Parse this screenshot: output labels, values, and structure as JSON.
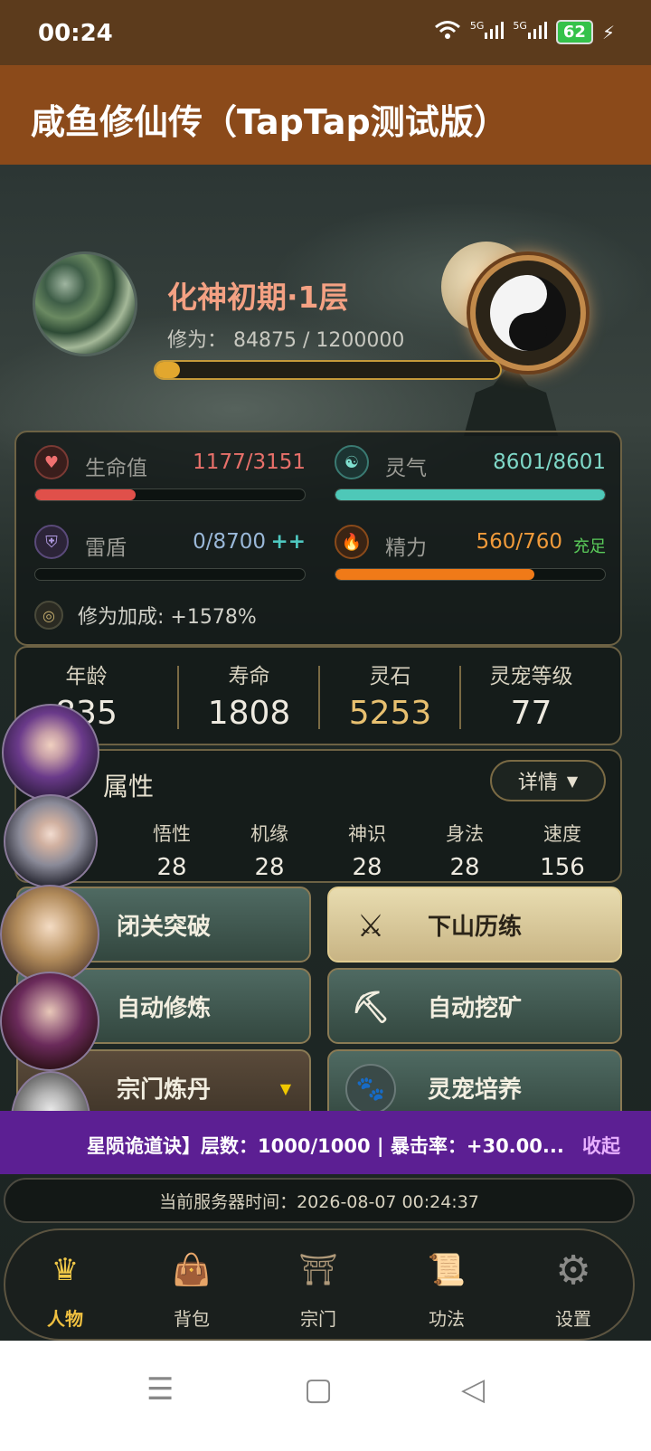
{
  "status_bar": {
    "time": "00:24",
    "signal1": "5G",
    "signal2": "5G",
    "battery": "62"
  },
  "app": {
    "title": "咸鱼修仙传（TapTap测试版）"
  },
  "player": {
    "realm": "化神初期·1层",
    "xiuwei_label": "修为：",
    "xiuwei_value": "84875 / 1200000",
    "xiuwei_progress": 0.071
  },
  "stats": {
    "hp": {
      "label": "生命值",
      "value": "1177/3151",
      "fraction": 0.373,
      "color": "#e0504a"
    },
    "qi": {
      "label": "灵气",
      "value": "8601/8601",
      "fraction": 1.0,
      "color": "#4ec8b8"
    },
    "shield": {
      "label": "雷盾",
      "value": "0/8700",
      "extra": "++",
      "fraction": 0.0,
      "color": "#4ec8c0"
    },
    "energy": {
      "label": "精力",
      "value": "560/760",
      "extra": "充足",
      "fraction": 0.737,
      "color": "#f07a18"
    },
    "bonus": "修为加成: +1578%"
  },
  "info": [
    {
      "label": "年龄",
      "value": "835"
    },
    {
      "label": "寿命",
      "value": "1808"
    },
    {
      "label": "灵石",
      "value": "5253"
    },
    {
      "label": "灵宠等级",
      "value": "77"
    }
  ],
  "attributes": {
    "title": "属性",
    "detail_button": "详情",
    "items": [
      {
        "label": "悟性",
        "value": "28"
      },
      {
        "label": "机缘",
        "value": "28"
      },
      {
        "label": "神识",
        "value": "28"
      },
      {
        "label": "身法",
        "value": "28"
      },
      {
        "label": "速度",
        "value": "156"
      }
    ]
  },
  "actions": {
    "breakthrough": "闭关突破",
    "adventure": "下山历练",
    "auto_cultivate": "自动修炼",
    "auto_mine": "自动挖矿",
    "alchemy": "宗门炼丹",
    "pet_train": "灵宠培养"
  },
  "buff": {
    "text": "星陨诡道诀】层数：1000/1000 | 暴击率：+30.00...",
    "collapse": "收起"
  },
  "server_time": "当前服务器时间：2026-08-07 00:24:37",
  "nav": {
    "character": "人物",
    "bag": "背包",
    "sect": "宗门",
    "skills": "功法",
    "settings": "设置"
  }
}
